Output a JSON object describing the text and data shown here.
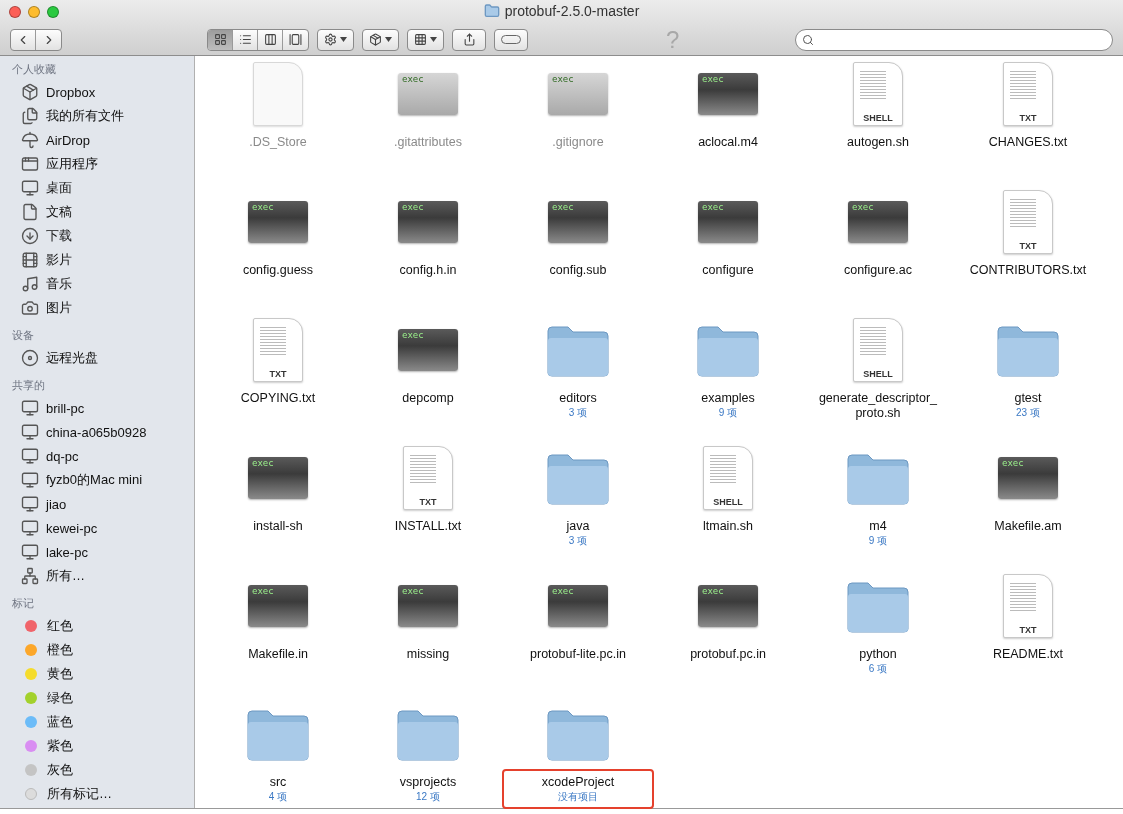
{
  "window": {
    "title": "protobuf-2.5.0-master"
  },
  "toolbar": {
    "views": [
      {
        "kind": "icons",
        "selected": true
      },
      {
        "kind": "list",
        "selected": false
      },
      {
        "kind": "columns",
        "selected": false
      },
      {
        "kind": "coverflow",
        "selected": false
      }
    ],
    "help": "?"
  },
  "sidebar": [
    {
      "heading": "个人收藏",
      "items": [
        {
          "label": "Dropbox",
          "kind": "dropbox"
        },
        {
          "label": "我的所有文件",
          "kind": "allfiles"
        },
        {
          "label": "AirDrop",
          "kind": "airdrop"
        },
        {
          "label": "应用程序",
          "kind": "apps"
        },
        {
          "label": "桌面",
          "kind": "desktop"
        },
        {
          "label": "文稿",
          "kind": "docs"
        },
        {
          "label": "下载",
          "kind": "downloads"
        },
        {
          "label": "影片",
          "kind": "movies"
        },
        {
          "label": "音乐",
          "kind": "music"
        },
        {
          "label": "图片",
          "kind": "pictures"
        }
      ]
    },
    {
      "heading": "设备",
      "items": [
        {
          "label": "远程光盘",
          "kind": "disc"
        }
      ]
    },
    {
      "heading": "共享的",
      "items": [
        {
          "label": "brill-pc",
          "kind": "pc"
        },
        {
          "label": "china-a065b0928",
          "kind": "pc"
        },
        {
          "label": "dq-pc",
          "kind": "pc"
        },
        {
          "label": "fyzb0的Mac mini",
          "kind": "mac"
        },
        {
          "label": "jiao",
          "kind": "pc"
        },
        {
          "label": "kewei-pc",
          "kind": "pc"
        },
        {
          "label": "lake-pc",
          "kind": "pc"
        },
        {
          "label": "所有…",
          "kind": "network"
        }
      ]
    },
    {
      "heading": "标记",
      "items": [
        {
          "label": "红色",
          "kind": "tag",
          "color": "#f0646a"
        },
        {
          "label": "橙色",
          "kind": "tag",
          "color": "#fca72a"
        },
        {
          "label": "黄色",
          "kind": "tag",
          "color": "#f5dc2c"
        },
        {
          "label": "绿色",
          "kind": "tag",
          "color": "#a3d12c"
        },
        {
          "label": "蓝色",
          "kind": "tag",
          "color": "#6cbcf8"
        },
        {
          "label": "紫色",
          "kind": "tag",
          "color": "#d98ef2"
        },
        {
          "label": "灰色",
          "kind": "tag",
          "color": "#c4c4c4"
        },
        {
          "label": "所有标记…",
          "kind": "alltags"
        }
      ]
    }
  ],
  "files": [
    {
      "name": ".DS_Store",
      "kind": "blank",
      "dimmed": true
    },
    {
      "name": ".gitattributes",
      "kind": "exec",
      "icon_label": "exec",
      "dimmed": true
    },
    {
      "name": ".gitignore",
      "kind": "exec",
      "icon_label": "exec",
      "dimmed": true
    },
    {
      "name": "aclocal.m4",
      "kind": "exec",
      "icon_label": "exec",
      "dimmed": false
    },
    {
      "name": "autogen.sh",
      "kind": "doc",
      "icon_label": "SHELL",
      "dimmed": false
    },
    {
      "name": "CHANGES.txt",
      "kind": "doc",
      "icon_label": "TXT",
      "dimmed": false
    },
    {
      "name": "config.guess",
      "kind": "exec",
      "icon_label": "exec",
      "dimmed": false
    },
    {
      "name": "config.h.in",
      "kind": "exec",
      "icon_label": "exec",
      "dimmed": false
    },
    {
      "name": "config.sub",
      "kind": "exec",
      "icon_label": "exec",
      "dimmed": false
    },
    {
      "name": "configure",
      "kind": "exec",
      "icon_label": "exec",
      "dimmed": false
    },
    {
      "name": "configure.ac",
      "kind": "exec",
      "icon_label": "exec",
      "dimmed": false
    },
    {
      "name": "CONTRIBUTORS.txt",
      "kind": "doc",
      "icon_label": "TXT",
      "dimmed": false
    },
    {
      "name": "COPYING.txt",
      "kind": "doc",
      "icon_label": "TXT",
      "dimmed": false
    },
    {
      "name": "depcomp",
      "kind": "exec",
      "icon_label": "exec",
      "dimmed": false
    },
    {
      "name": "editors",
      "kind": "folder",
      "count": "3 项",
      "dimmed": false
    },
    {
      "name": "examples",
      "kind": "folder",
      "count": "9 项",
      "dimmed": false
    },
    {
      "name": "generate_descriptor_proto.sh",
      "kind": "doc",
      "icon_label": "SHELL",
      "dimmed": false
    },
    {
      "name": "gtest",
      "kind": "folder",
      "count": "23 项",
      "dimmed": false
    },
    {
      "name": "install-sh",
      "kind": "exec",
      "icon_label": "exec",
      "dimmed": false
    },
    {
      "name": "INSTALL.txt",
      "kind": "doc",
      "icon_label": "TXT",
      "dimmed": false
    },
    {
      "name": "java",
      "kind": "folder",
      "count": "3 项",
      "dimmed": false
    },
    {
      "name": "ltmain.sh",
      "kind": "doc",
      "icon_label": "SHELL",
      "dimmed": false
    },
    {
      "name": "m4",
      "kind": "folder",
      "count": "9 项",
      "dimmed": false
    },
    {
      "name": "Makefile.am",
      "kind": "exec",
      "icon_label": "exec",
      "dimmed": false
    },
    {
      "name": "Makefile.in",
      "kind": "exec",
      "icon_label": "exec",
      "dimmed": false
    },
    {
      "name": "missing",
      "kind": "exec",
      "icon_label": "exec",
      "dimmed": false
    },
    {
      "name": "protobuf-lite.pc.in",
      "kind": "exec",
      "icon_label": "exec",
      "dimmed": false
    },
    {
      "name": "protobuf.pc.in",
      "kind": "exec",
      "icon_label": "exec",
      "dimmed": false
    },
    {
      "name": "python",
      "kind": "folder",
      "count": "6 项",
      "dimmed": false
    },
    {
      "name": "README.txt",
      "kind": "doc",
      "icon_label": "TXT",
      "dimmed": false
    },
    {
      "name": "src",
      "kind": "folder",
      "count": "4 项",
      "dimmed": false
    },
    {
      "name": "vsprojects",
      "kind": "folder",
      "count": "12 项",
      "dimmed": false
    },
    {
      "name": "xcodeProject",
      "kind": "folder",
      "count": "没有项目",
      "dimmed": false,
      "highlighted": true
    }
  ]
}
